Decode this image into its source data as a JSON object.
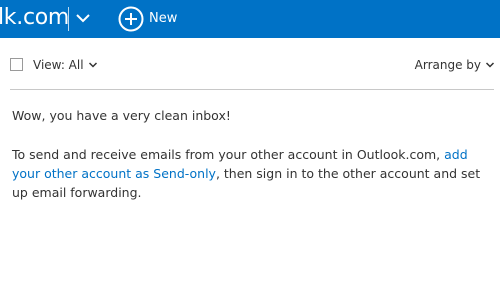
{
  "header": {
    "brand_text": "lk.com",
    "new_label": "New",
    "accent_color": "#0072c6",
    "icons": {
      "menu": "chevron-down-icon",
      "new": "plus-circle-icon"
    }
  },
  "toolbar": {
    "view_label": "View: All",
    "arrange_label": "Arrange by"
  },
  "message": {
    "title": "Wow, you have a very clean inbox!",
    "body_before": "To send and receive emails from your other account in Outlook.com, ",
    "link_text": "add your other account as Send-only",
    "body_after": ", then sign in to the other account and set up email forwarding."
  }
}
